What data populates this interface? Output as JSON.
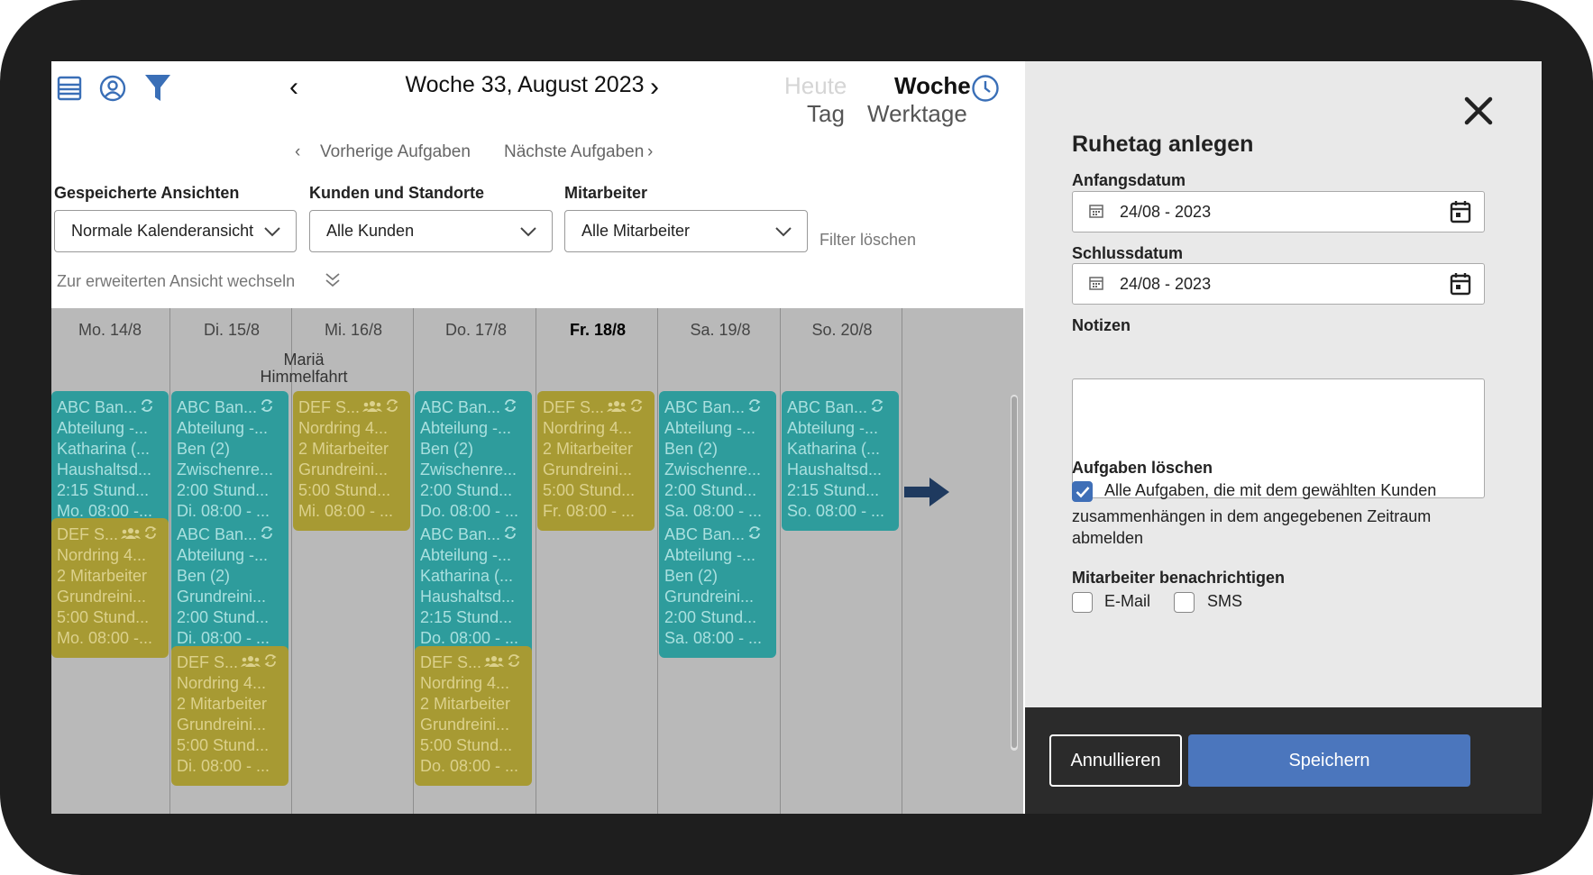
{
  "toolbar": {
    "week_title": "Woche 33, August 2023",
    "prev_arrow": "‹",
    "next_arrow": "›",
    "views": {
      "heute": "Heute",
      "woche": "Woche",
      "tag": "Tag",
      "werktage": "Werktage"
    }
  },
  "task_nav": {
    "prev": "Vorherige Aufgaben",
    "next": "Nächste Aufgaben"
  },
  "filters": {
    "saved_views": {
      "label": "Gespeicherte Ansichten",
      "value": "Normale Kalenderansicht"
    },
    "customers": {
      "label": "Kunden und Standorte",
      "value": "Alle Kunden"
    },
    "employees": {
      "label": "Mitarbeiter",
      "value": "Alle Mitarbeiter"
    },
    "clear": "Filter löschen",
    "switch_view": "Zur erweiterten Ansicht wechseln"
  },
  "calendar": {
    "days": [
      "Mo. 14/8",
      "Di. 15/8",
      "Mi. 16/8",
      "Do. 17/8",
      "Fr. 18/8",
      "Sa. 19/8",
      "So. 20/8"
    ],
    "holiday": "Mariä Himmelfahrt",
    "cards": [
      {
        "color": "teal",
        "lines": [
          "ABC Ban...",
          "Abteilung -...",
          "Katharina (...",
          "Haushaltsd...",
          "2:15 Stund...",
          "Mo. 08:00 -..."
        ]
      },
      {
        "color": "gold",
        "lines": [
          "DEF S...",
          "Nordring 4...",
          "2 Mitarbeiter",
          "Grundreini...",
          "5:00 Stund...",
          "Mo. 08:00 -..."
        ]
      },
      {
        "color": "teal",
        "lines": [
          "ABC Ban...",
          "Abteilung -...",
          "Ben (2)",
          "Zwischenre...",
          "2:00 Stund...",
          "Di. 08:00 - ..."
        ]
      },
      {
        "color": "teal",
        "lines": [
          "ABC Ban...",
          "Abteilung -...",
          "Ben (2)",
          "Grundreini...",
          "2:00 Stund...",
          "Di. 08:00 - ..."
        ]
      },
      {
        "color": "gold",
        "lines": [
          "DEF S...",
          "Nordring 4...",
          "2 Mitarbeiter",
          "Grundreini...",
          "5:00 Stund...",
          "Di. 08:00 - ..."
        ]
      },
      {
        "color": "gold",
        "lines": [
          "DEF S...",
          "Nordring 4...",
          "2 Mitarbeiter",
          "Grundreini...",
          "5:00 Stund...",
          "Mi. 08:00 - ..."
        ]
      },
      {
        "color": "teal",
        "lines": [
          "ABC Ban...",
          "Abteilung -...",
          "Ben (2)",
          "Zwischenre...",
          "2:00 Stund...",
          "Do. 08:00 - ..."
        ]
      },
      {
        "color": "teal",
        "lines": [
          "ABC Ban...",
          "Abteilung -...",
          "Katharina (...",
          "Haushaltsd...",
          "2:15 Stund...",
          "Do. 08:00 - ..."
        ]
      },
      {
        "color": "gold",
        "lines": [
          "DEF S...",
          "Nordring 4...",
          "2 Mitarbeiter",
          "Grundreini...",
          "5:00 Stund...",
          "Do. 08:00 - ..."
        ]
      },
      {
        "color": "gold",
        "lines": [
          "DEF S...",
          "Nordring 4...",
          "2 Mitarbeiter",
          "Grundreini...",
          "5:00 Stund...",
          "Fr. 08:00 - ..."
        ]
      },
      {
        "color": "teal",
        "lines": [
          "ABC Ban...",
          "Abteilung -...",
          "Ben (2)",
          "Zwischenre...",
          "2:00 Stund...",
          "Sa. 08:00 - ..."
        ]
      },
      {
        "color": "teal",
        "lines": [
          "ABC Ban...",
          "Abteilung -...",
          "Ben (2)",
          "Grundreini...",
          "2:00 Stund...",
          "Sa. 08:00 - ..."
        ]
      },
      {
        "color": "teal",
        "lines": [
          "ABC Ban...",
          "Abteilung -...",
          "Katharina (...",
          "Haushaltsd...",
          "2:15 Stund...",
          "So. 08:00 - ..."
        ]
      }
    ]
  },
  "panel": {
    "title": "Ruhetag anlegen",
    "start_label": "Anfangsdatum",
    "start_value": "24/08 - 2023",
    "end_label": "Schlussdatum",
    "end_value": "24/08 - 2023",
    "notes_label": "Notizen",
    "delete_label": "Aufgaben löschen",
    "delete_text_1": "Alle Aufgaben, die mit dem gewählten Kunden",
    "delete_text_2": "zusammenhängen in dem angegebenen Zeitraum",
    "delete_text_3": "abmelden",
    "notify_label": "Mitarbeiter benachrichtigen",
    "email": "E-Mail",
    "sms": "SMS",
    "cancel": "Annullieren",
    "save": "Speichern"
  },
  "colors": {
    "teal": "#2e9c9c",
    "gold": "#a79a33",
    "accent": "#4b76bd",
    "icon_blue": "#3a6fb7"
  }
}
